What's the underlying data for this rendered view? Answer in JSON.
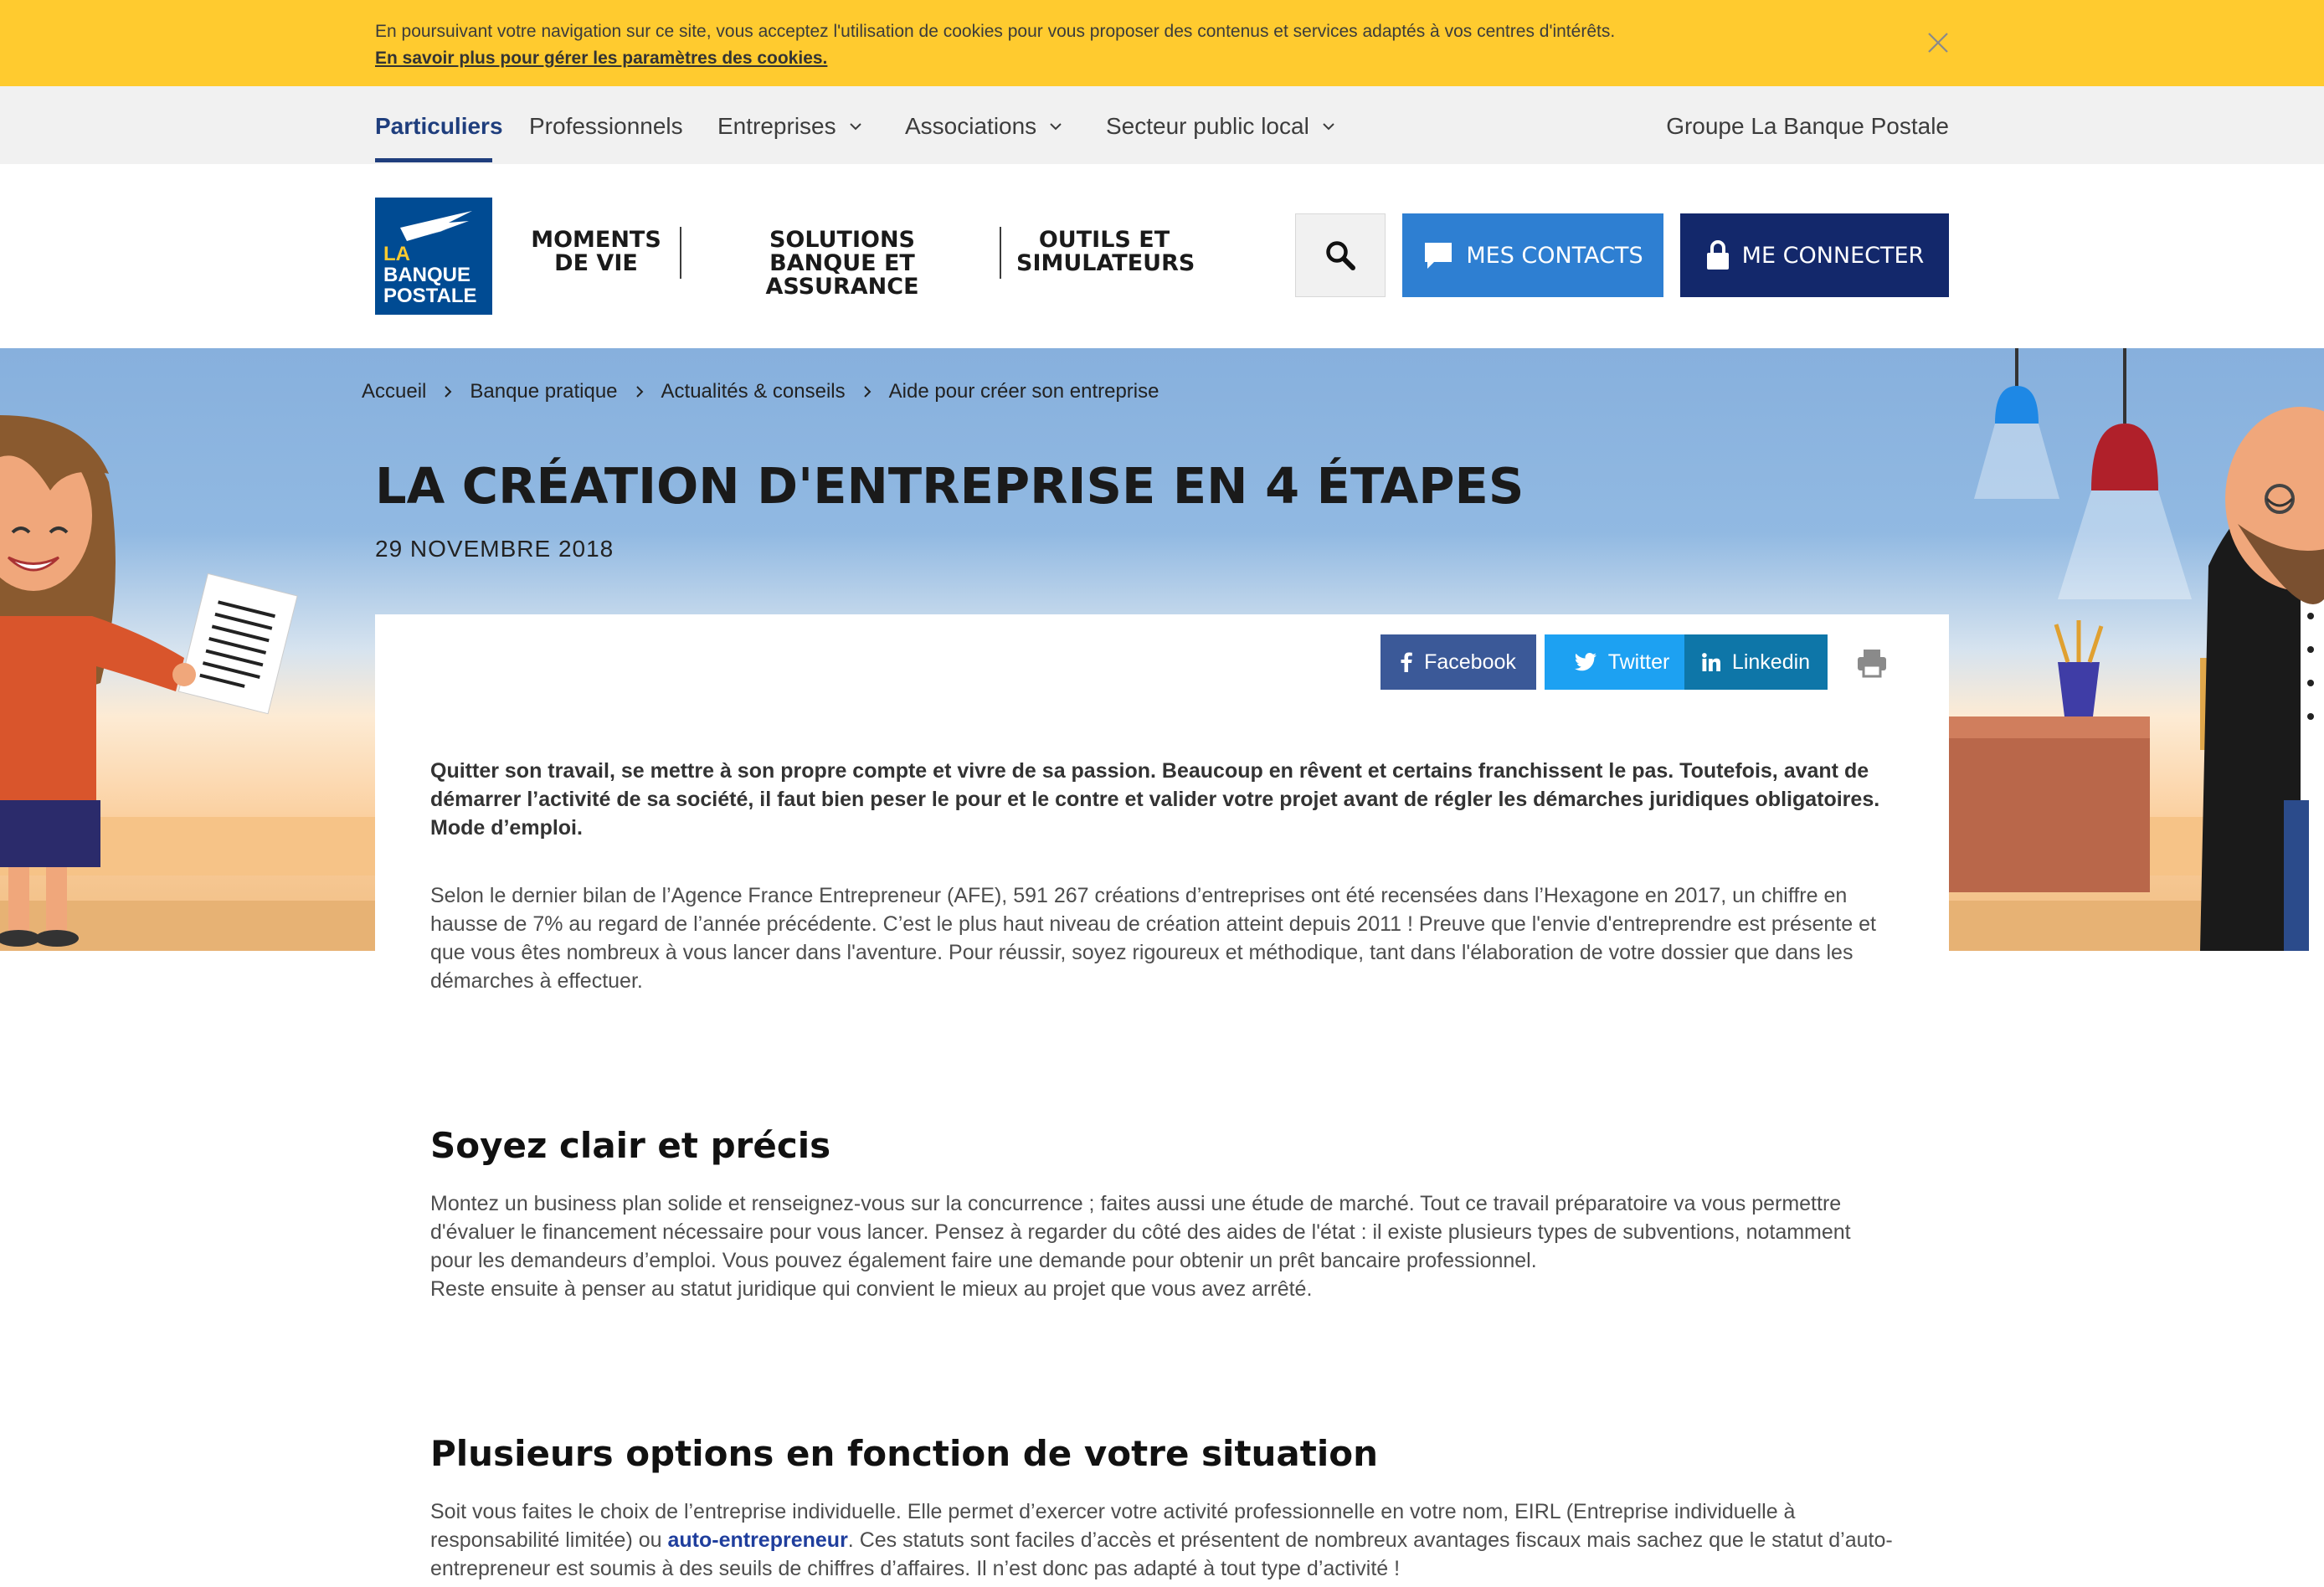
{
  "cookie_banner": {
    "text": "En poursuivant votre navigation sur ce site, vous acceptez l'utilisation de cookies pour vous proposer des contenus et services adaptés à vos centres d'intérêts.",
    "link": "En savoir plus pour gérer les paramètres des cookies."
  },
  "top_nav": {
    "items": [
      "Particuliers",
      "Professionnels",
      "Entreprises",
      "Associations",
      "Secteur public local"
    ],
    "group_link": "Groupe La Banque Postale"
  },
  "logo": {
    "line1": "LA",
    "line2": "BANQUE",
    "line3": "POSTALE"
  },
  "main_nav": [
    {
      "line1": "MOMENTS",
      "line2": "DE VIE"
    },
    {
      "line1": "SOLUTIONS",
      "line2": "BANQUE ET ASSURANCE"
    },
    {
      "line1": "OUTILS ET",
      "line2": "SIMULATEURS"
    }
  ],
  "actions": {
    "contacts": "MES CONTACTS",
    "connect": "ME CONNECTER"
  },
  "breadcrumb": [
    "Accueil",
    "Banque pratique",
    "Actualités & conseils",
    "Aide pour créer son entreprise"
  ],
  "article": {
    "title": "LA CRÉATION D'ENTREPRISE EN 4 ÉTAPES",
    "date": "29 NOVEMBRE 2018",
    "share": {
      "facebook": "Facebook",
      "twitter": "Twitter",
      "linkedin": "Linkedin"
    },
    "intro": "Quitter son travail, se mettre à son propre compte et vivre de sa passion. Beaucoup en rêvent et certains franchissent le pas. Toutefois, avant de démarrer l’activité de sa société, il faut bien peser le pour et le contre et valider votre projet avant de régler les démarches juridiques obligatoires. Mode d’emploi.",
    "para1": "Selon le dernier bilan de l’Agence France Entrepreneur (AFE), 591 267 créations d’entreprises ont été recensées dans l’Hexagone en 2017, un chiffre en hausse de 7% au regard de l’année précédente. C’est le plus haut niveau de création atteint depuis 2011 ! Preuve que l'envie d'entreprendre est présente et que vous êtes nombreux à vous lancer dans l'aventure. Pour réussir, soyez rigoureux et méthodique, tant dans l'élaboration de votre dossier que dans les démarches à effectuer.",
    "section1": {
      "heading": "Soyez clair et précis",
      "text1": "Montez un business plan solide et renseignez-vous sur la concurrence ; faites aussi une étude de marché. Tout ce travail préparatoire va vous permettre d'évaluer le financement nécessaire pour vous lancer. Pensez à regarder du côté des aides de l'état : il existe plusieurs types de subventions, notamment pour les demandeurs d’emploi. Vous pouvez également faire une demande pour obtenir un prêt bancaire professionnel.",
      "text2": "Reste ensuite à penser au statut juridique qui convient le mieux au projet que vous avez arrêté."
    },
    "section2": {
      "heading": "Plusieurs options en fonction de votre situation",
      "text_before": "Soit vous faites le choix de l’entreprise individuelle. Elle permet d’exercer votre activité professionnelle en votre nom, EIRL (Entreprise individuelle à responsabilité limitée) ou ",
      "link": "auto-entrepreneur",
      "text_after": ". Ces statuts sont faciles d’accès et présentent de nombreux avantages fiscaux mais sachez que le statut d’auto-entrepreneur est soumis à des seuils de chiffres d’affaires. Il n’est donc pas adapté à tout type d’activité !"
    }
  },
  "colors": {
    "cookie_bg": "#ffcb2f",
    "brand_blue": "#1f3e7d",
    "contacts_blue": "#2e7fd2",
    "connect_navy": "#13286b",
    "facebook": "#3b5998",
    "twitter": "#1da1f2",
    "linkedin": "#0e76a8"
  }
}
